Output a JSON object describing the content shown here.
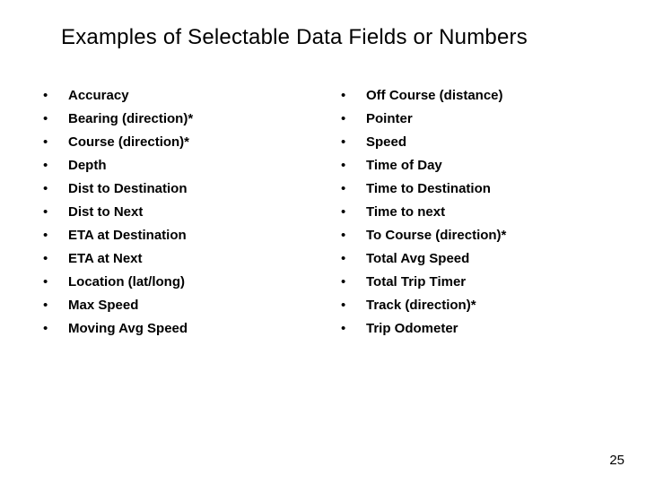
{
  "title": "Examples of Selectable Data Fields or Numbers",
  "left_items": [
    "Accuracy",
    "Bearing  (direction)*",
    "Course (direction)*",
    "Depth",
    "Dist to Destination",
    "Dist to Next",
    "ETA at Destination",
    "ETA at Next",
    "Location (lat/long)",
    "Max Speed",
    "Moving Avg Speed"
  ],
  "right_items": [
    "Off Course (distance)",
    "Pointer",
    "Speed",
    "Time of Day",
    "Time to Destination",
    "Time to next",
    "To Course (direction)*",
    "Total Avg Speed",
    "Total Trip Timer",
    "Track (direction)*",
    "Trip Odometer"
  ],
  "bullet": "•",
  "page_number": "25"
}
